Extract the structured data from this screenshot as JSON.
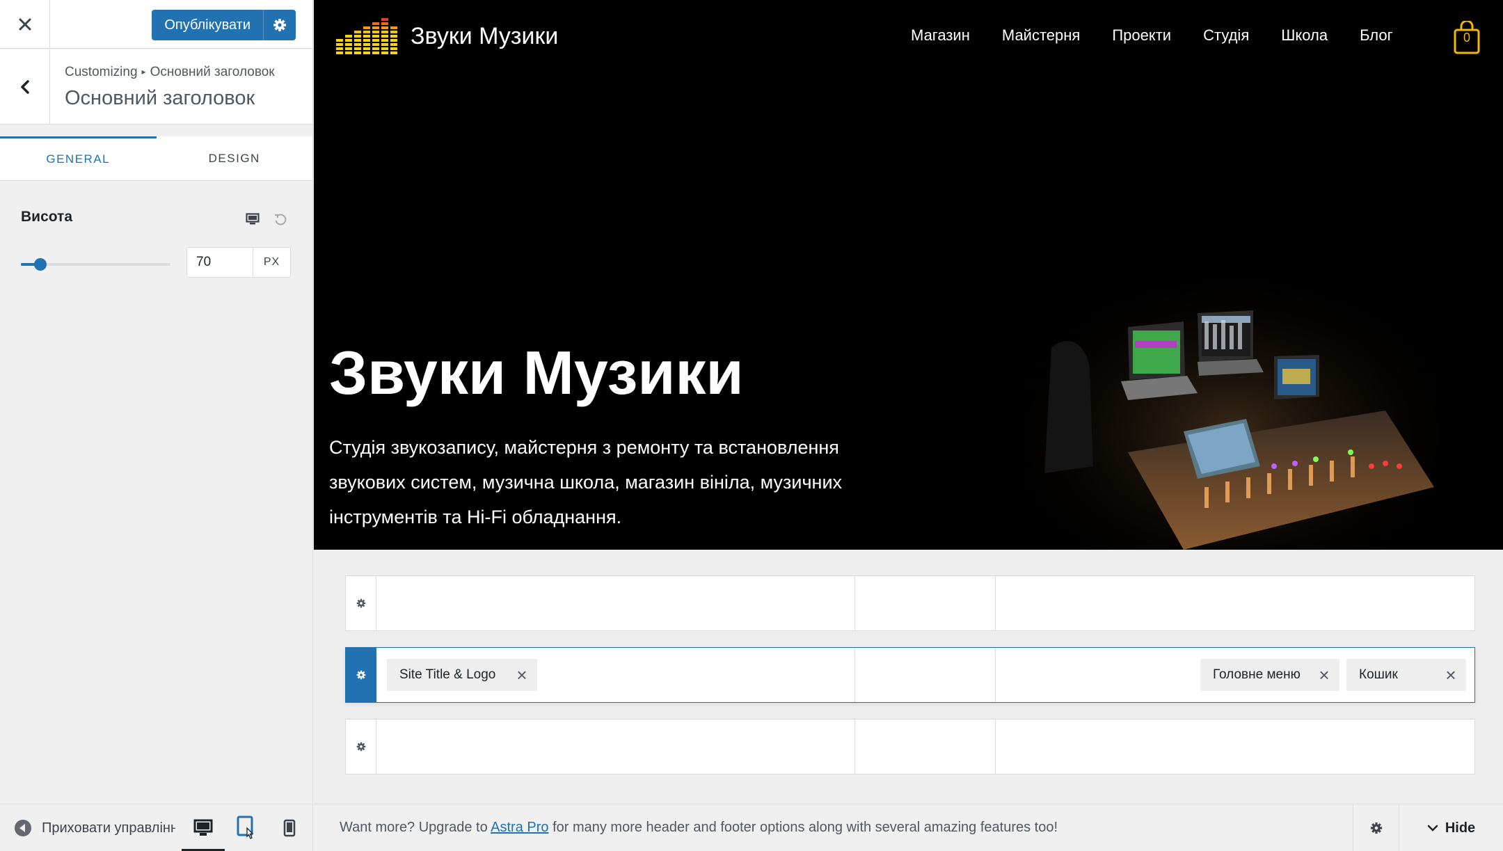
{
  "sidebar": {
    "publish_label": "Опублікувати",
    "breadcrumb_root": "Customizing",
    "breadcrumb_current": "Основний заголовок",
    "section_title": "Основний заголовок",
    "tabs": [
      {
        "label": "GENERAL",
        "active": true
      },
      {
        "label": "DESIGN",
        "active": false
      }
    ],
    "height_control": {
      "label": "Висота",
      "value": "70",
      "unit": "PX",
      "slider_fraction": 0.13
    },
    "footer": {
      "collapse_label": "Приховати управління",
      "devices": [
        {
          "name": "desktop-icon",
          "active": true
        },
        {
          "name": "tablet-icon",
          "active": false
        },
        {
          "name": "mobile-icon",
          "active": false
        }
      ]
    }
  },
  "preview": {
    "site_title": "Звуки Музики",
    "nav": [
      "Магазин",
      "Майстерня",
      "Проекти",
      "Студія",
      "Школа",
      "Блог"
    ],
    "cart_count": "0",
    "hero_title": "Звуки Музики",
    "hero_desc_lines": [
      "Студія звукозапису, майстерня з ремонту та встановлення",
      "звукових систем, музична школа, магазин вініла, музичних",
      "інструментів та Hi-Fi обладнання."
    ]
  },
  "builder": {
    "primary_items": {
      "left": {
        "label": "Site Title & Logo"
      },
      "right": [
        {
          "label": "Головне меню"
        },
        {
          "label": "Кошик"
        }
      ]
    }
  },
  "bottom_bar": {
    "upsell_before": "Want more? Upgrade to ",
    "upsell_link": "Astra Pro",
    "upsell_after": " for many more header and footer options along with several amazing features too!",
    "hide_label": "Hide"
  },
  "colors": {
    "accent": "#2271b1",
    "cart_yellow": "#f5b800",
    "hero_bg": "#000000"
  }
}
